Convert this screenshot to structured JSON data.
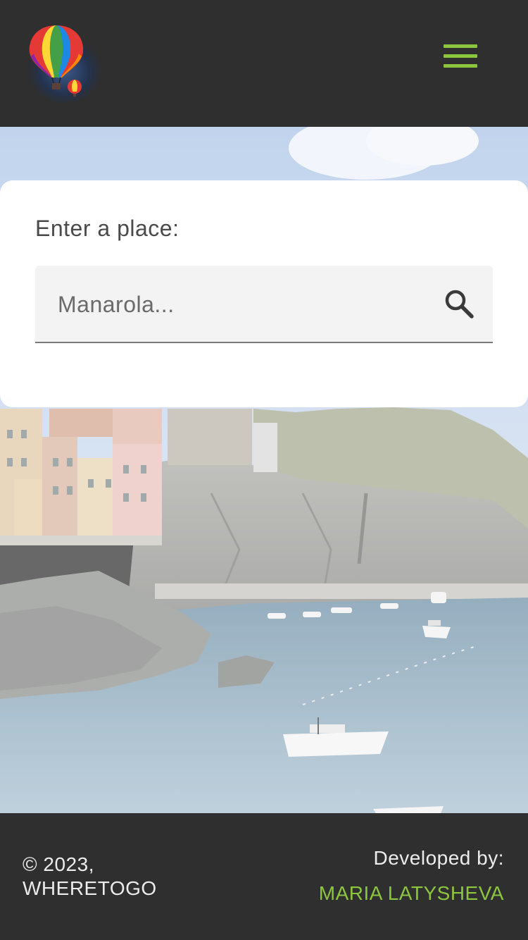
{
  "header": {
    "logo_icon": "hot-air-balloon-logo-icon",
    "menu_icon": "hamburger-menu-icon"
  },
  "search": {
    "label": "Enter a place:",
    "value": "",
    "placeholder": "Manarola...",
    "button_icon": "search-icon"
  },
  "hero": {
    "image_subject": "coastal-village-harbor-photo"
  },
  "footer": {
    "copyright_line1": "© 2023,",
    "copyright_line2": "WHERETOGO",
    "developed_by_label": "Developed by:",
    "developer_name": "MARIA LATYSHEVA"
  },
  "colors": {
    "header_bg": "#2f2f2f",
    "accent": "#8cc63f",
    "card_bg": "#ffffff",
    "field_bg": "#f3f3f3"
  }
}
